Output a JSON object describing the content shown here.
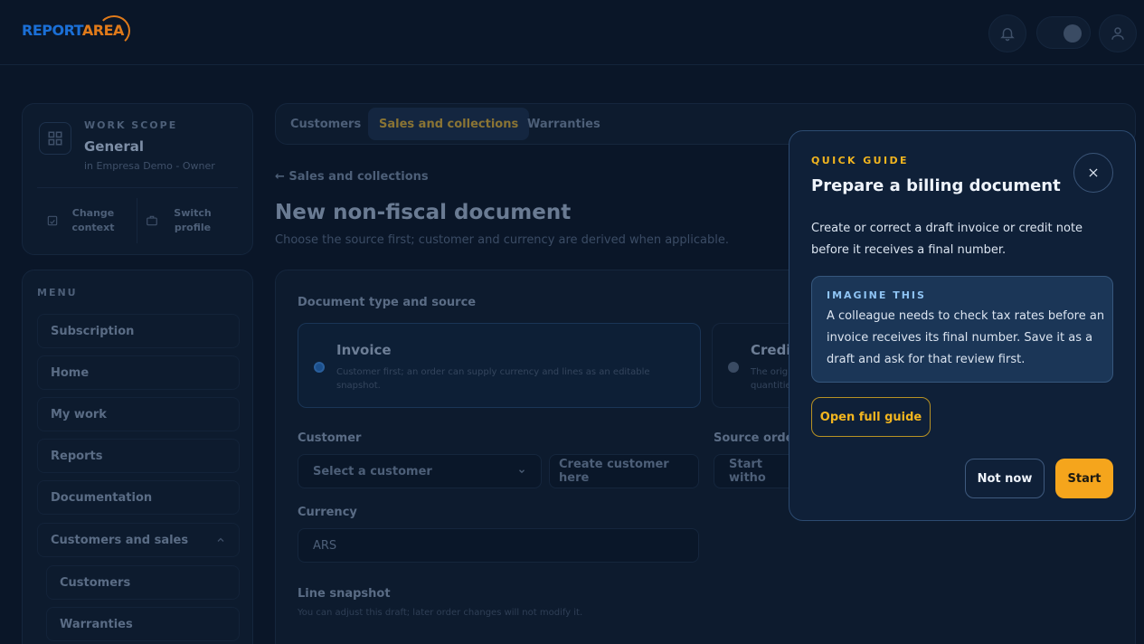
{
  "brand": {
    "part1": "REPORT",
    "part2": "AREA"
  },
  "topbar": {
    "icons": [
      "bell-icon",
      "theme-toggle",
      "user-icon"
    ]
  },
  "scope": {
    "kicker": "WORK SCOPE",
    "title": "General",
    "subtitle": "in Empresa Demo - Owner",
    "change_context": "Change context",
    "switch_profile": "Switch profile"
  },
  "menu": {
    "kicker": "MENU",
    "items": [
      "Subscription",
      "Home",
      "My work",
      "Reports",
      "Documentation",
      "Customers and sales"
    ],
    "subitems": [
      "Customers",
      "Warranties"
    ]
  },
  "tabs": [
    "Customers",
    "Sales and collections",
    "Warranties"
  ],
  "page": {
    "back": "← Sales and collections",
    "title": "New non-fiscal document",
    "subtitle": "Choose the source first; customer and currency are derived when applicable."
  },
  "form": {
    "section_type": "Document type and source",
    "invoice_title": "Invoice",
    "invoice_desc": "Customer first; an order can supply currency and lines as an editable snapshot.",
    "credit_title": "Credit",
    "credit_desc": "The orig quantitie",
    "customer_label": "Customer",
    "customer_select": "Select a customer",
    "create_customer": "Create customer here",
    "source_label": "Source order",
    "source_value": "Start witho",
    "currency_label": "Currency",
    "currency_value": "ARS",
    "line_label": "Line snapshot",
    "line_hint": "You can adjust this draft; later order changes will not modify it."
  },
  "guide": {
    "kicker": "QUICK GUIDE",
    "title": "Prepare a billing document",
    "body": "Create or correct a draft invoice or credit note before it receives a final number.",
    "box_kicker": "IMAGINE THIS",
    "box_text": "A colleague needs to check tax rates before an invoice receives its final number. Save it as a draft and ask for that review first.",
    "open_full": "Open full guide",
    "not_now": "Not now",
    "start": "Start"
  },
  "colors": {
    "accent": "#f5a51c",
    "kicker": "#f2b51f",
    "info": "#8fc4f4",
    "brand_blue": "#1b6fd6",
    "brand_orange": "#e07a1a"
  }
}
